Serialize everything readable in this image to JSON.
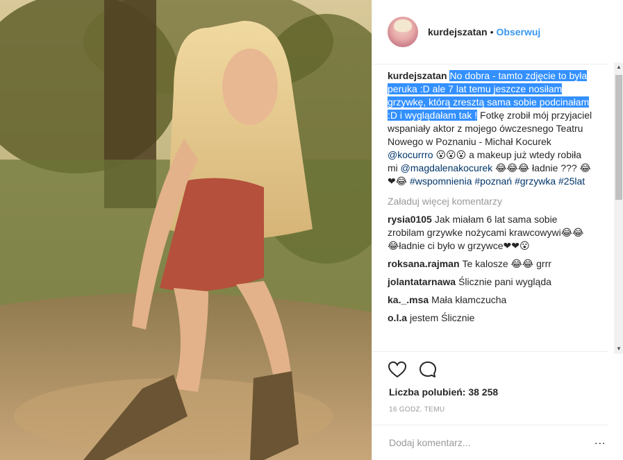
{
  "post": {
    "username": "kurdejszatan",
    "separator": "•",
    "follow_label": "Obserwuj"
  },
  "caption": {
    "username": "kurdejszatan",
    "highlighted_text": "No dobra - tamto zdjęcie to była peruka :D ale 7 lat temu jeszcze nosiłam grzywkę, którą zresztą sama sobie podcinałam :D i wyglądałam tak !",
    "text_1": " Fotkę zrobił mój przyjaciel wspaniały aktor z mojego ówczesnego Teatru Nowego w Poznaniu - Michał Kocurek ",
    "mention_1": "@kocurrro",
    "text_2": " 😮😮😮 a makeup już wtedy robiła mi ",
    "mention_2": "@magdalenakocurek",
    "text_3": " 😂😂😂 ładnie ??? 😂❤😂 ",
    "hashtag_1": "#wspomnienia",
    "hashtag_2": "#poznań",
    "hashtag_3": "#grzywka",
    "hashtag_4": "#25lat"
  },
  "load_more_label": "Załaduj więcej komentarzy",
  "comments": [
    {
      "user": "rysia0105",
      "text": "Jak miałam 6 lat sama sobie zrobilam grzywke nożycami krawcowywi😂😂😂ładnie ci było w grzywce❤❤😮"
    },
    {
      "user": "roksana.rajman",
      "text": "Te kalosze 😂😂 grrr"
    },
    {
      "user": "jolantatarnawa",
      "text": "Ślicznie pani wygląda"
    },
    {
      "user": "ka._.msa",
      "text": "Mała kłamczucha"
    },
    {
      "user": "o.l.a",
      "text": "jestem Ślicznie"
    }
  ],
  "likes_label": "Liczba polubień: 38 258",
  "time_label": "16 GODZ. TEMU",
  "add_comment_placeholder": "Dodaj komentarz...",
  "more_label": "...",
  "icons": {
    "like": "heart-icon",
    "comment": "speech-bubble-icon",
    "scroll_up": "▲",
    "scroll_down": "▼"
  },
  "colors": {
    "accent": "#3897f0",
    "selection": "#3390ff",
    "link": "#003569",
    "muted": "#999999"
  }
}
